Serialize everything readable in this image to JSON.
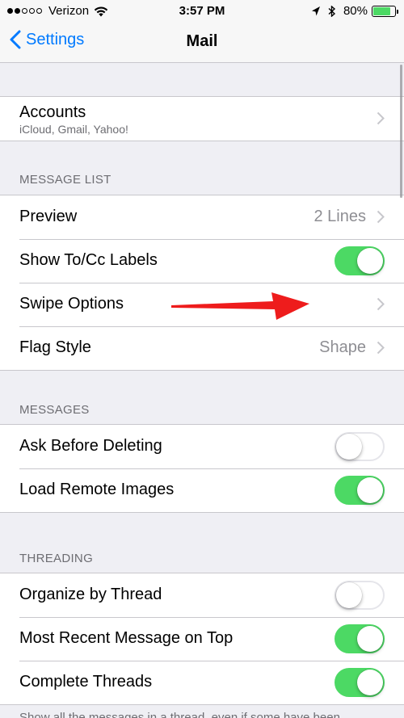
{
  "status_bar": {
    "carrier": "Verizon",
    "time": "3:57 PM",
    "battery": "80%",
    "signal_bars_filled": 2,
    "signal_bars_total": 5,
    "battery_level": 0.8
  },
  "nav": {
    "back_label": "Settings",
    "title": "Mail"
  },
  "accounts": {
    "label": "Accounts",
    "subtitle": "iCloud, Gmail, Yahoo!"
  },
  "message_list": {
    "header": "MESSAGE LIST",
    "preview": {
      "label": "Preview",
      "value": "2 Lines"
    },
    "show_to_cc": {
      "label": "Show To/Cc Labels",
      "on": true
    },
    "swipe_options": {
      "label": "Swipe Options"
    },
    "flag_style": {
      "label": "Flag Style",
      "value": "Shape"
    }
  },
  "messages": {
    "header": "MESSAGES",
    "ask_before_deleting": {
      "label": "Ask Before Deleting",
      "on": false
    },
    "load_remote_images": {
      "label": "Load Remote Images",
      "on": true
    }
  },
  "threading": {
    "header": "THREADING",
    "organize_by_thread": {
      "label": "Organize by Thread",
      "on": false
    },
    "most_recent_on_top": {
      "label": "Most Recent Message on Top",
      "on": true
    },
    "complete_threads": {
      "label": "Complete Threads",
      "on": true
    }
  },
  "footer": "Show all the messages in a thread, even if some have been",
  "colors": {
    "accent": "#007aff",
    "toggle_on": "#4cd964",
    "annotation_arrow": "#ee1c1c"
  }
}
